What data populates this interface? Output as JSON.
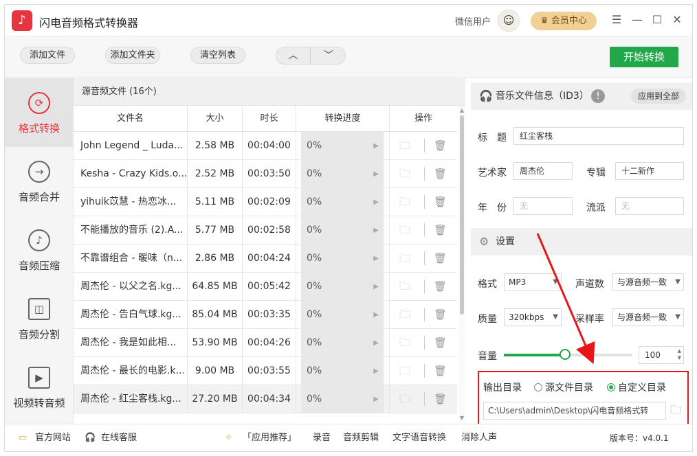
{
  "app": {
    "title": "闪电音频格式转换器",
    "user": "微信用户",
    "vip": "会员中心",
    "logo_glyph": "♪"
  },
  "toolbar": {
    "add_file": "添加文件",
    "add_folder": "添加文件夹",
    "clear_list": "清空列表",
    "up": "︿",
    "down": "﹀",
    "start": "开始转换"
  },
  "nav": [
    {
      "label": "格式转换",
      "icon": "⟳",
      "active": true
    },
    {
      "label": "音频合并",
      "icon": "→"
    },
    {
      "label": "音频压缩",
      "icon": "♪"
    },
    {
      "label": "音频分割",
      "icon": "◫"
    },
    {
      "label": "视频转音频",
      "icon": "▶"
    }
  ],
  "list": {
    "header": "源音频文件 (16个)",
    "columns": [
      "文件名",
      "大小",
      "时长",
      "转换进度",
      "操作"
    ],
    "rows": [
      {
        "name": "John Legend _ Luda...",
        "size": "2.58 MB",
        "duration": "00:04:00",
        "progress": "0%"
      },
      {
        "name": "Kesha - Crazy Kids.o...",
        "size": "2.52 MB",
        "duration": "00:03:50",
        "progress": "0%"
      },
      {
        "name": "yihuik苡慧 - 热恋冰...",
        "size": "5.11 MB",
        "duration": "00:02:09",
        "progress": "0%"
      },
      {
        "name": "不能播放的音乐 (2).A...",
        "size": "5.77 MB",
        "duration": "00:02:58",
        "progress": "0%"
      },
      {
        "name": "不靠谱组合 - 暖味（n...",
        "size": "2.86 MB",
        "duration": "00:04:24",
        "progress": "0%"
      },
      {
        "name": "周杰伦 - 以父之名.kg...",
        "size": "64.85 MB",
        "duration": "00:05:42",
        "progress": "0%"
      },
      {
        "name": "周杰伦 - 告白气球.kg...",
        "size": "85.04 MB",
        "duration": "00:03:35",
        "progress": "0%"
      },
      {
        "name": "周杰伦 - 我是如此相...",
        "size": "53.90 MB",
        "duration": "00:04:26",
        "progress": "0%"
      },
      {
        "name": "周杰伦 - 最长的电影.k...",
        "size": "9.00 MB",
        "duration": "00:03:55",
        "progress": "0%"
      },
      {
        "name": "周杰伦 - 红尘客栈.kg...",
        "size": "27.20 MB",
        "duration": "00:04:34",
        "progress": "0%"
      }
    ]
  },
  "id3": {
    "header": "音乐文件信息（ID3）",
    "apply_all": "应用到全部",
    "title_label": "标　题",
    "title_value": "红尘客栈",
    "artist_label": "艺术家",
    "artist_value": "周杰伦",
    "album_label": "专辑",
    "album_value": "十二新作",
    "year_label": "年　份",
    "year_value": "无",
    "genre_label": "流派",
    "genre_value": "无"
  },
  "settings": {
    "header": "设置",
    "format_label": "格式",
    "format_value": "MP3",
    "channels_label": "声道数",
    "channels_value": "与源音频一致",
    "quality_label": "质量",
    "quality_value": "320kbps",
    "samplerate_label": "采样率",
    "samplerate_value": "与源音频一致",
    "volume_label": "音量",
    "volume_value": "100",
    "volume_fraction": 0.48,
    "output_label": "输出目录",
    "opt_source": "源文件目录",
    "opt_custom": "自定义目录",
    "path": "C:\\Users\\admin\\Desktop\\闪电音频格式转"
  },
  "footer": {
    "website": "官方网站",
    "service": "在线客服",
    "recommend": "「应用推荐」",
    "record": "录音",
    "edit": "音频剪辑",
    "tts": "文字语音转换",
    "vocal": "消除人声",
    "version": "版本号：v4.0.1"
  },
  "colors": {
    "accent": "#e8343f",
    "green": "#22a84b",
    "highlight": "#e8151b"
  }
}
